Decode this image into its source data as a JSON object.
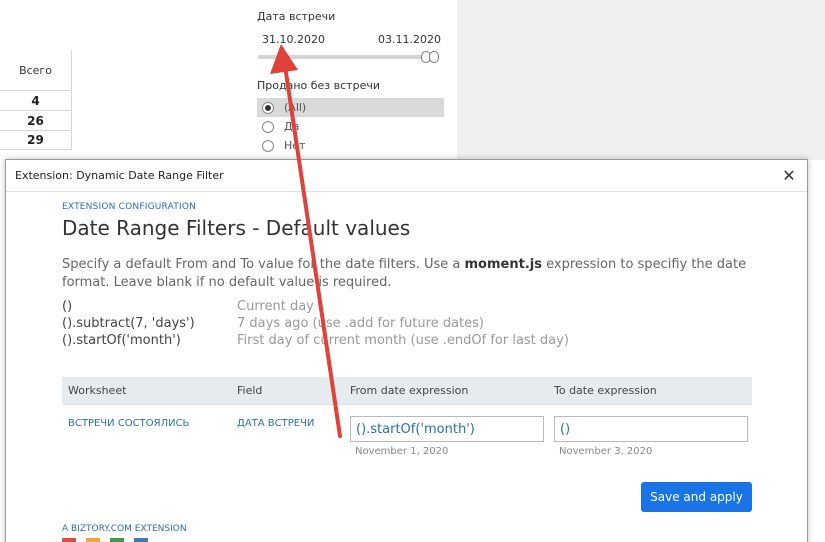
{
  "dashboard": {
    "table": {
      "header": "Всего",
      "values": [
        "4",
        "26",
        "29"
      ]
    },
    "date_filter": {
      "title": "Дата встречи",
      "from": "31.10.2020",
      "to": "03.11.2020"
    },
    "sold_filter": {
      "title": "Продано без встречи",
      "options": [
        {
          "label": "(All)",
          "selected": true
        },
        {
          "label": "Да",
          "selected": false
        },
        {
          "label": "Нет",
          "selected": false
        }
      ]
    }
  },
  "dialog": {
    "window_title": "Extension: Dynamic Date Range Filter",
    "close_label": "✕",
    "subtitle": "EXTENSION CONFIGURATION",
    "title": "Date Range Filters - Default values",
    "description_prefix": "Specify a default From and To value for the date filters. Use a ",
    "description_strong": "moment.js",
    "description_suffix": " expression to specifiy the date format. Leave blank if no default value is required.",
    "examples": [
      {
        "expr": "()",
        "meaning": "Current day"
      },
      {
        "expr": "().subtract(7, 'days')",
        "meaning": "7 days ago (use .add for future dates)"
      },
      {
        "expr": "().startOf('month')",
        "meaning": "First day of current month (use .endOf for last day)"
      }
    ],
    "grid": {
      "headers": {
        "worksheet": "Worksheet",
        "field": "Field",
        "from": "From date expression",
        "to": "To date expression"
      },
      "rows": [
        {
          "worksheet": "ВСТРЕЧИ СОСТОЯЛИСЬ",
          "field": "ДАТА ВСТРЕЧИ",
          "from_value": "().startOf('month')",
          "from_hint": "November 1, 2020",
          "to_value": "()",
          "to_hint": "November 3, 2020"
        }
      ]
    },
    "save_label": "Save and apply",
    "footer": "A BIZTORY.COM EXTENSION"
  },
  "colors": {
    "accent": "#1a74e8",
    "link": "#2a6fb0",
    "arrow": "#e0413a"
  }
}
